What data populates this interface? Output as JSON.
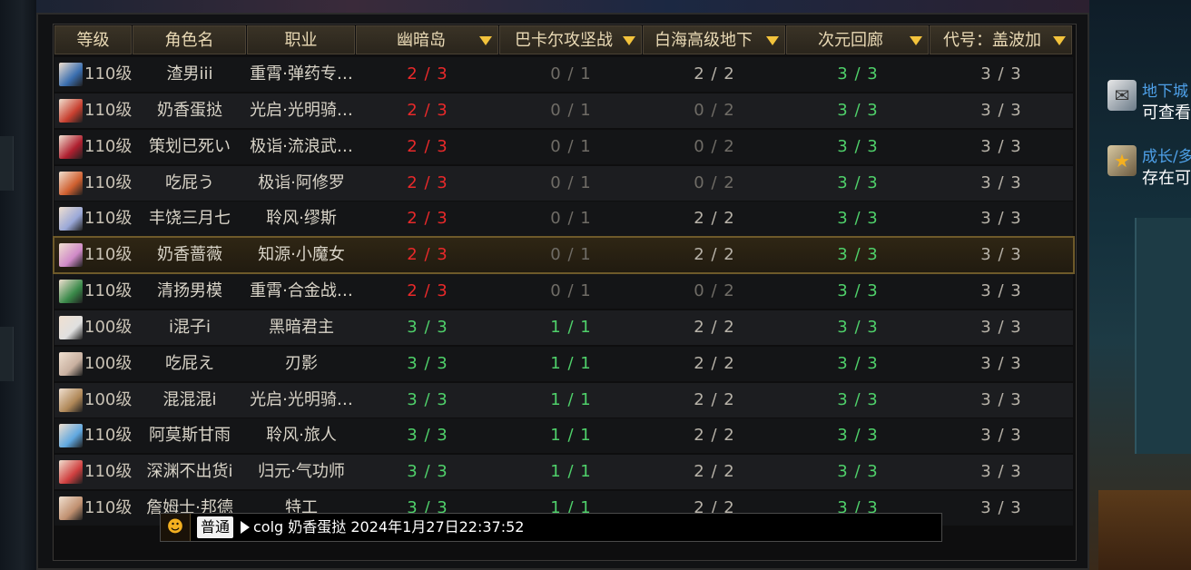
{
  "colors": {
    "red": "#e8292a",
    "green": "#4fd06a",
    "gray": "#6f6c66",
    "light_gray": "#b7b2a8",
    "header_text": "#e9d9b4",
    "sort_triangle": "#f3c33c"
  },
  "side_notices": [
    {
      "title": "地下城",
      "text": "可查看",
      "icon": "scroll-icon"
    },
    {
      "title": "成长/多",
      "text": "存在可",
      "icon": "star-icon"
    }
  ],
  "table": {
    "headers": {
      "level": "等级",
      "name": "角色名",
      "job": "职业",
      "d1": "幽暗岛",
      "d2": "巴卡尔攻坚战",
      "d3": "白海高级地下",
      "d4": "次元回廊",
      "d5": "代号：盖波加"
    },
    "rows": [
      {
        "level": "110级",
        "name": "渣男iii",
        "job": "重霄·弹药专…",
        "d1": "2 / 3",
        "d2": "0 / 1",
        "d3": "2 / 2",
        "d4": "3 / 3",
        "d5": "3 / 3",
        "avatar": "#3b6fb0"
      },
      {
        "level": "110级",
        "name": "奶香蛋挞",
        "job": "光启·光明骑…",
        "d1": "2 / 3",
        "d2": "0 / 1",
        "d3": "0 / 2",
        "d4": "3 / 3",
        "d5": "3 / 3",
        "avatar": "#c84030"
      },
      {
        "level": "110级",
        "name": "策划已死い",
        "job": "极诣·流浪武…",
        "d1": "2 / 3",
        "d2": "0 / 1",
        "d3": "0 / 2",
        "d4": "3 / 3",
        "d5": "3 / 3",
        "avatar": "#b02030"
      },
      {
        "level": "110级",
        "name": "吃屁う",
        "job": "极诣·阿修罗",
        "d1": "2 / 3",
        "d2": "0 / 1",
        "d3": "0 / 2",
        "d4": "3 / 3",
        "d5": "3 / 3",
        "avatar": "#d06030"
      },
      {
        "level": "110级",
        "name": "丰饶三月七",
        "job": "聆风·缪斯",
        "d1": "2 / 3",
        "d2": "0 / 1",
        "d3": "2 / 2",
        "d4": "3 / 3",
        "d5": "3 / 3",
        "avatar": "#9aa8d8"
      },
      {
        "level": "110级",
        "name": "奶香蔷薇",
        "job": "知源·小魔女",
        "d1": "2 / 3",
        "d2": "0 / 1",
        "d3": "2 / 2",
        "d4": "3 / 3",
        "d5": "3 / 3",
        "avatar": "#d08ac8",
        "selected": true
      },
      {
        "level": "110级",
        "name": "清扬男模",
        "job": "重霄·合金战…",
        "d1": "2 / 3",
        "d2": "0 / 1",
        "d3": "0 / 2",
        "d4": "3 / 3",
        "d5": "3 / 3",
        "avatar": "#3a8a4a"
      },
      {
        "level": "100级",
        "name": "i混子i",
        "job": "黑暗君主",
        "d1": "3 / 3",
        "d2": "1 / 1",
        "d3": "2 / 2",
        "d4": "3 / 3",
        "d5": "3 / 3",
        "avatar": "#e0e0e0"
      },
      {
        "level": "100级",
        "name": "吃屁え",
        "job": "刃影",
        "d1": "3 / 3",
        "d2": "1 / 1",
        "d3": "2 / 2",
        "d4": "3 / 3",
        "d5": "3 / 3",
        "avatar": "#c8b0a0"
      },
      {
        "level": "100级",
        "name": "混混混i",
        "job": "光启·光明骑…",
        "d1": "3 / 3",
        "d2": "1 / 1",
        "d3": "2 / 2",
        "d4": "3 / 3",
        "d5": "3 / 3",
        "avatar": "#b08858"
      },
      {
        "level": "110级",
        "name": "阿莫斯甘雨",
        "job": "聆风·旅人",
        "d1": "3 / 3",
        "d2": "1 / 1",
        "d3": "2 / 2",
        "d4": "3 / 3",
        "d5": "3 / 3",
        "avatar": "#60a8e0"
      },
      {
        "level": "110级",
        "name": "深渊不出货i",
        "job": "归元·气功师",
        "d1": "3 / 3",
        "d2": "1 / 1",
        "d3": "2 / 2",
        "d4": "3 / 3",
        "d5": "3 / 3",
        "avatar": "#d04040"
      },
      {
        "level": "110级",
        "name": "詹姆士·邦德",
        "job": "特工",
        "d1": "3 / 3",
        "d2": "1 / 1",
        "d3": "2 / 2",
        "d4": "3 / 3",
        "d5": "3 / 3",
        "avatar": "#c09070"
      }
    ]
  },
  "chat": {
    "channel": "普通",
    "message": "colg 奶香蛋挞 2024年1月27日22:37:52",
    "emote_icon": "smiley-icon"
  }
}
